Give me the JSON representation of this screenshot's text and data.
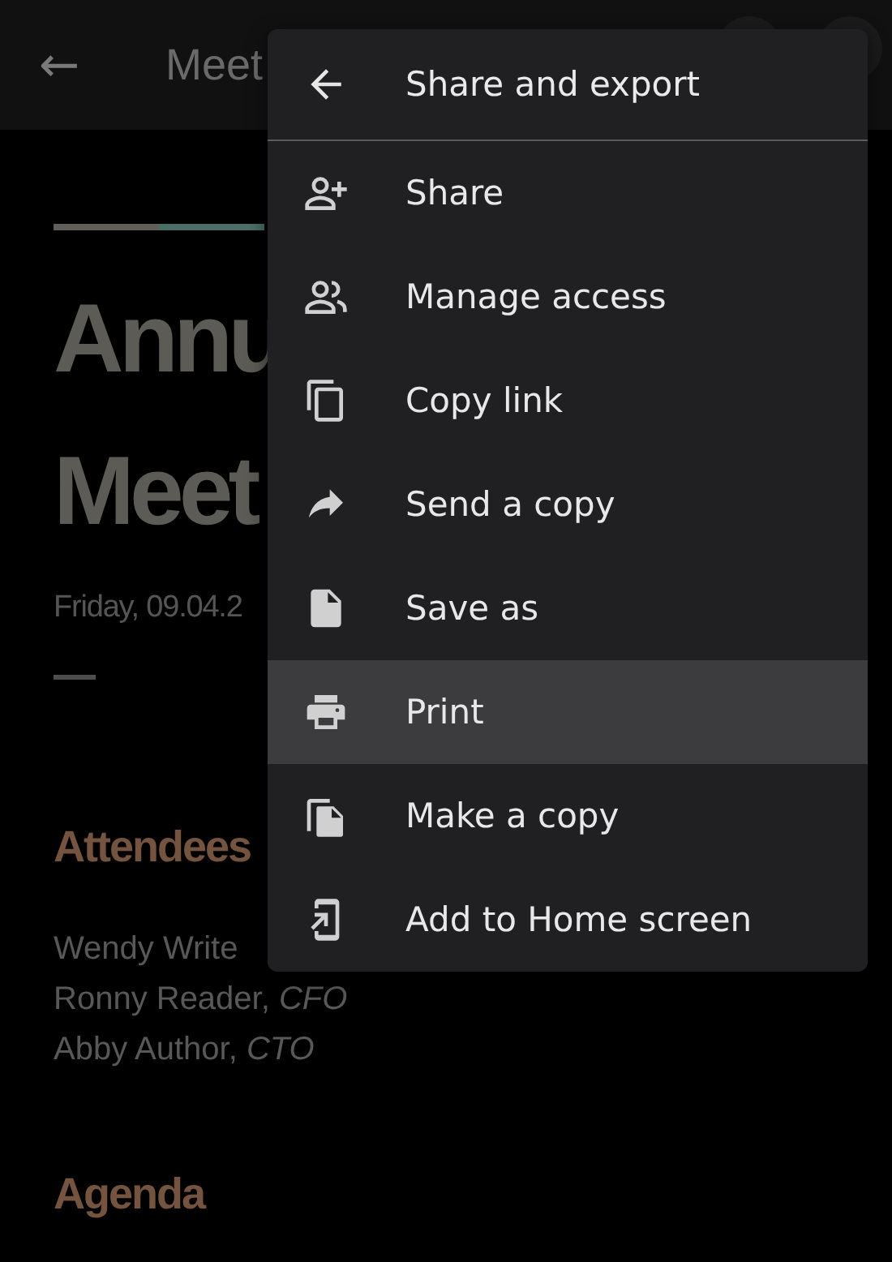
{
  "app_bar": {
    "back": "←",
    "title": "Meet"
  },
  "document": {
    "title_lines": [
      "Annu",
      "Meet"
    ],
    "date": "Friday, 09.04.2",
    "sections": [
      {
        "heading": "Attendees",
        "lines": [
          "Wendy Write",
          "Ronny Reader, *CFO*",
          "Abby Author, *CTO*"
        ]
      },
      {
        "heading": "Agenda"
      }
    ]
  },
  "menu": {
    "title": "Share and export",
    "items": [
      {
        "label": "Share",
        "selected": false
      },
      {
        "label": "Manage access",
        "selected": false
      },
      {
        "label": "Copy link",
        "selected": false
      },
      {
        "label": "Send a copy",
        "selected": false
      },
      {
        "label": "Save as",
        "selected": false
      },
      {
        "label": "Print",
        "selected": true
      },
      {
        "label": "Make a copy",
        "selected": false
      },
      {
        "label": "Add to Home screen",
        "selected": false
      }
    ]
  }
}
